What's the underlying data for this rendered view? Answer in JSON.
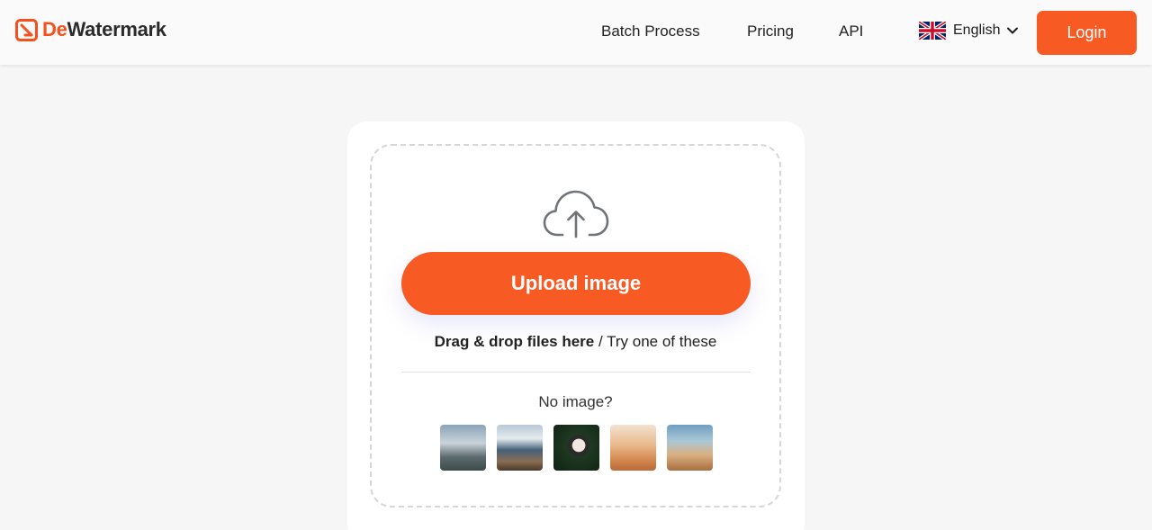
{
  "brand": {
    "name_prefix": "De",
    "name_suffix": "Watermark",
    "accent": "#f85a24",
    "logo_icon": "crop-square-icon"
  },
  "nav": {
    "links": [
      {
        "label": "Batch Process"
      },
      {
        "label": "Pricing"
      },
      {
        "label": "API"
      }
    ],
    "language": {
      "label": "English",
      "flag_icon": "uk-flag-icon",
      "chevron_icon": "chevron-down-icon"
    },
    "login_label": "Login"
  },
  "upload": {
    "icon": "cloud-upload-icon",
    "button_label": "Upload image",
    "drag_text": "Drag & drop files here",
    "separator": " / ",
    "try_text": "Try one of these",
    "no_image_text": "No image?",
    "samples": [
      {
        "icon": "sample-house-image"
      },
      {
        "icon": "sample-lake-image"
      },
      {
        "icon": "sample-woman-image"
      },
      {
        "icon": "sample-desert-image"
      },
      {
        "icon": "sample-dunes-image"
      }
    ]
  }
}
